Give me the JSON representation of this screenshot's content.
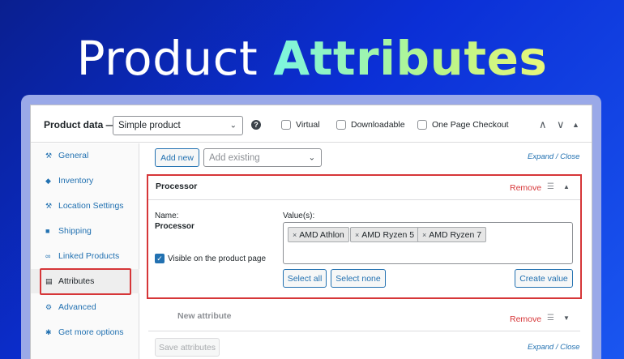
{
  "hero": {
    "title_plain": "Product",
    "title_accent": "Attributes"
  },
  "header": {
    "label": "Product data —",
    "product_type": "Simple product",
    "help": "?",
    "checkboxes": [
      "Virtual",
      "Downloadable",
      "One Page Checkout"
    ],
    "arrows": [
      "∧",
      "∨",
      "▲"
    ]
  },
  "sidebar": {
    "items": [
      {
        "label": "General",
        "icon": "wrench-icon"
      },
      {
        "label": "Inventory",
        "icon": "tag-icon"
      },
      {
        "label": "Location Settings",
        "icon": "wrench-icon"
      },
      {
        "label": "Shipping",
        "icon": "truck-icon"
      },
      {
        "label": "Linked Products",
        "icon": "link-icon"
      },
      {
        "label": "Attributes",
        "icon": "table-icon"
      },
      {
        "label": "Advanced",
        "icon": "gear-icon"
      },
      {
        "label": "Get more options",
        "icon": "plugin-icon"
      }
    ],
    "active_index": 5
  },
  "toolbar": {
    "add_new": "Add new",
    "add_existing_placeholder": "Add existing",
    "expand_close": "Expand / Close"
  },
  "attribute": {
    "title": "Processor",
    "remove": "Remove",
    "name_label": "Name:",
    "name_value": "Processor",
    "values_label": "Value(s):",
    "values": [
      "AMD Athlon",
      "AMD Ryzen 5",
      "AMD Ryzen 7"
    ],
    "visible_label": "Visible on the product page",
    "select_all": "Select all",
    "select_none": "Select none",
    "create_value": "Create value"
  },
  "new_attribute": {
    "title": "New attribute",
    "remove": "Remove"
  },
  "footer": {
    "save": "Save attributes",
    "expand_close": "Expand / Close"
  },
  "colors": {
    "accent_blue": "#2271b1",
    "remove_red": "#d63638",
    "highlight_red": "#d63638"
  }
}
